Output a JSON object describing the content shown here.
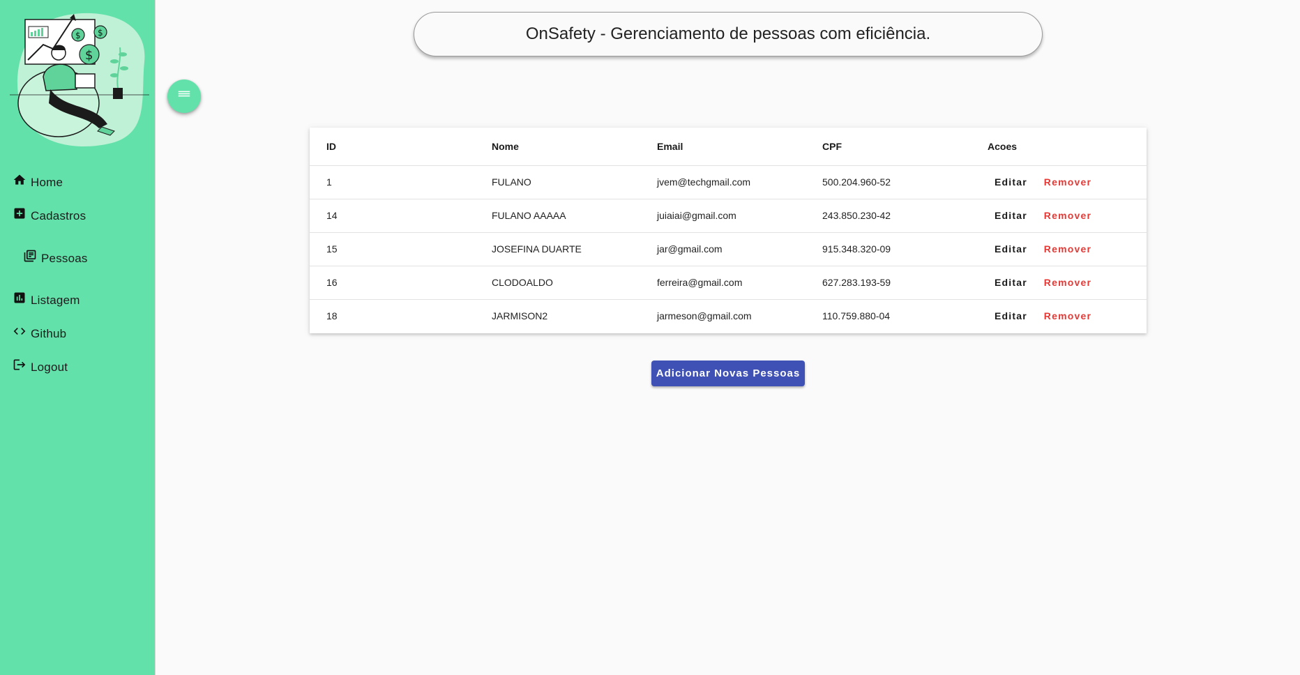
{
  "header": {
    "title": "OnSafety - Gerenciamento de pessoas com eficiência."
  },
  "sidebar": {
    "items": [
      {
        "label": "Home",
        "icon": "home-icon"
      },
      {
        "label": "Cadastros",
        "icon": "add-box-icon"
      },
      {
        "label": "Pessoas",
        "icon": "library-icon"
      },
      {
        "label": "Listagem",
        "icon": "chart-icon"
      },
      {
        "label": "Github",
        "icon": "code-icon"
      },
      {
        "label": "Logout",
        "icon": "logout-icon"
      }
    ]
  },
  "table": {
    "columns": [
      "ID",
      "Nome",
      "Email",
      "CPF",
      "Acoes"
    ],
    "rows": [
      {
        "id": "1",
        "nome": "FULANO",
        "email": "jvem@techgmail.com",
        "cpf": "500.204.960-52"
      },
      {
        "id": "14",
        "nome": "FULANO AAAAA",
        "email": "juiaiai@gmail.com",
        "cpf": "243.850.230-42"
      },
      {
        "id": "15",
        "nome": "JOSEFINA DUARTE",
        "email": "jar@gmail.com",
        "cpf": "915.348.320-09"
      },
      {
        "id": "16",
        "nome": "CLODOALDO",
        "email": "ferreira@gmail.com",
        "cpf": "627.283.193-59"
      },
      {
        "id": "18",
        "nome": "JARMISON2",
        "email": "jarmeson@gmail.com",
        "cpf": "110.759.880-04"
      }
    ],
    "edit_label": "Editar",
    "remove_label": "Remover"
  },
  "add_button_label": "Adicionar Novas Pessoas",
  "colors": {
    "sidebar": "#62e2aa",
    "primary": "#3f51b5",
    "danger": "#e53935",
    "background": "#fafafa"
  }
}
